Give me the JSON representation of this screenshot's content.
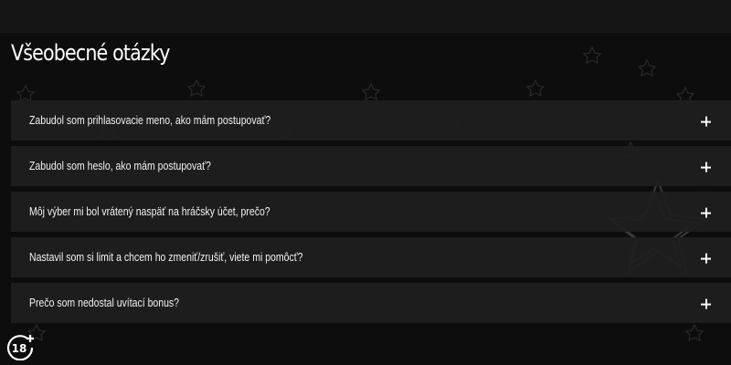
{
  "section": {
    "title": "Všeobecné otázky"
  },
  "faq": {
    "items": [
      {
        "question": "Zabudol som prihlasovacie meno, ako mám postupovať?"
      },
      {
        "question": "Zabudol som heslo, ako mám postupovať?"
      },
      {
        "question": "Môj výber mi bol vrátený naspäť na hráčsky účet, prečo?"
      },
      {
        "question": "Nastavil som si limit a chcem ho zmeniť/zrušiť, viete mi pomôcť?"
      },
      {
        "question": "Prečo som nedostal uvítací bonus?"
      }
    ],
    "expand_icon": "plus-icon"
  },
  "badge": {
    "label": "18+"
  },
  "colors": {
    "background": "#0d0d0d",
    "item_background": "#1e1e1e",
    "text": "#ffffff"
  }
}
